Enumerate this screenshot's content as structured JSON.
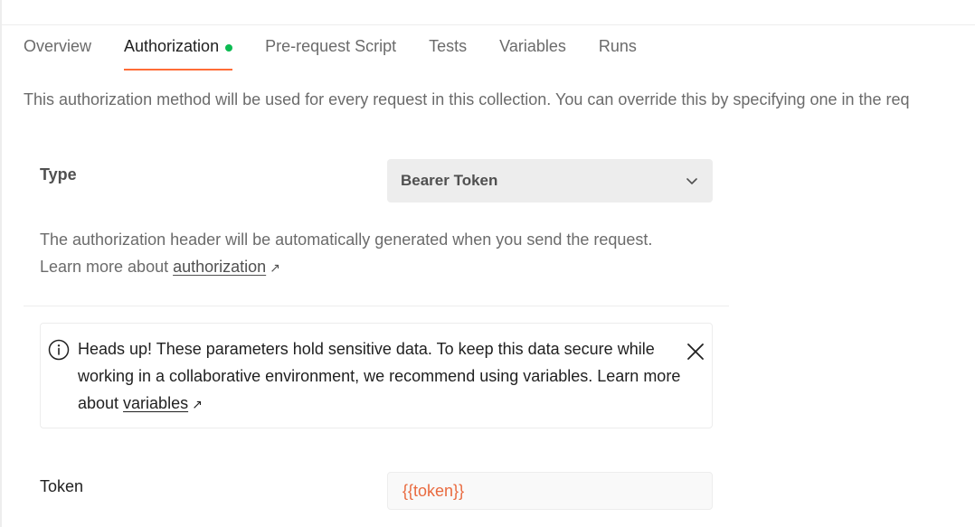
{
  "tabs": [
    {
      "label": "Overview",
      "active": false
    },
    {
      "label": "Authorization",
      "active": true,
      "status_dot_color": "#0cbb52"
    },
    {
      "label": "Pre-request Script",
      "active": false
    },
    {
      "label": "Tests",
      "active": false
    },
    {
      "label": "Variables",
      "active": false
    },
    {
      "label": "Runs",
      "active": false
    }
  ],
  "auth": {
    "description": "This authorization method will be used for every request in this collection. You can override this by specifying one in the req",
    "type_label": "Type",
    "type_value": "Bearer Token",
    "help_prefix": "The authorization header will be automatically generated when you send the request. Learn more about ",
    "help_link": "authorization",
    "help_link_arrow": "↗"
  },
  "alert": {
    "icon": "info-icon",
    "message_prefix": "Heads up! These parameters hold sensitive data. To keep this data secure while working in a collaborative environment, we recommend using variables. Learn more about ",
    "link": "variables",
    "link_arrow": "↗",
    "close_icon": "close-icon"
  },
  "token": {
    "label": "Token",
    "value": "{{token}}"
  },
  "colors": {
    "accent": "#ff6c37",
    "variable_text": "#e96a3f",
    "status_dot": "#0cbb52"
  }
}
